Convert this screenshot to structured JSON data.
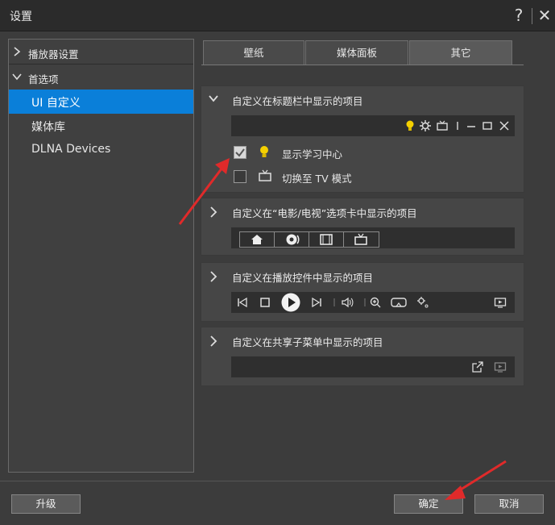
{
  "window": {
    "title": "设置",
    "help_glyph": "?",
    "close_glyph": "✕"
  },
  "sidebar": {
    "groups": [
      {
        "label": "播放器设置",
        "expanded": false
      },
      {
        "label": "首选项",
        "expanded": true
      }
    ],
    "items": [
      {
        "label": "UI 自定义",
        "selected": true
      },
      {
        "label": "媒体库",
        "selected": false
      },
      {
        "label": "DLNA Devices",
        "selected": false
      }
    ]
  },
  "tabs": [
    {
      "label": "壁纸",
      "active": false
    },
    {
      "label": "媒体面板",
      "active": false
    },
    {
      "label": "其它",
      "active": true
    }
  ],
  "sections": {
    "titlebar_items": {
      "heading": "自定义在标题栏中显示的项目",
      "expanded": true,
      "bar_icons": [
        "bulb-icon",
        "gear-icon",
        "tv-icon",
        "separator",
        "minimize-icon",
        "maximize-icon",
        "close-icon"
      ],
      "options": [
        {
          "label": "显示学习中心",
          "checked": true,
          "icon": "bulb-icon"
        },
        {
          "label": "切换至 TV 模式",
          "checked": false,
          "icon": "tv-icon"
        }
      ]
    },
    "movie_tab_items": {
      "heading": "自定义在“电影/电视”选项卡中显示的项目",
      "expanded": false,
      "icons": [
        "home-icon",
        "disc-icon",
        "film-icon",
        "tv-icon"
      ]
    },
    "playback_items": {
      "heading": "自定义在播放控件中显示的项目",
      "expanded": false,
      "icons": [
        "previous-icon",
        "stop-icon",
        "play-icon",
        "next-icon",
        "volume-icon",
        "zoom-icon",
        "vr-icon",
        "settings-icon",
        "screen-icon"
      ]
    },
    "share_items": {
      "heading": "自定义在共享子菜单中显示的项目",
      "expanded": false,
      "icons": [
        "share-out-icon",
        "cast-icon"
      ]
    }
  },
  "footer": {
    "upgrade_label": "升级",
    "ok_label": "确定",
    "cancel_label": "取消"
  },
  "colors": {
    "accent": "#0a7fd9",
    "bulb": "#f5d000",
    "arrow": "#e02a2a"
  }
}
